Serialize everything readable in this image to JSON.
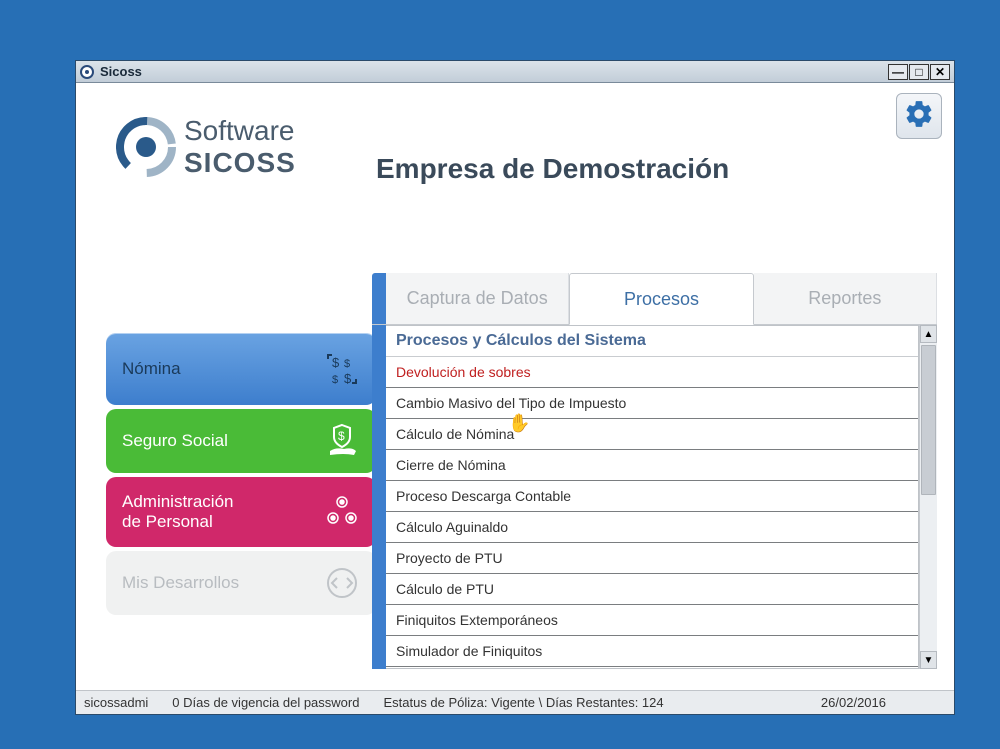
{
  "window": {
    "title": "Sicoss"
  },
  "logo": {
    "line1": "Software",
    "line2": "SICOSS"
  },
  "company": "Empresa de Demostración",
  "sidebar": {
    "items": [
      {
        "label": "Nómina"
      },
      {
        "label": "Seguro Social"
      },
      {
        "label": "Administración\nde Personal"
      },
      {
        "label": "Mis Desarrollos"
      }
    ]
  },
  "tabs": {
    "items": [
      {
        "label": "Captura de Datos"
      },
      {
        "label": "Procesos"
      },
      {
        "label": "Reportes"
      }
    ]
  },
  "list": {
    "header": "Procesos y Cálculos del Sistema",
    "items": [
      "Devolución de sobres",
      "Cambio Masivo del Tipo de Impuesto",
      "Cálculo de Nómina",
      "Cierre de Nómina",
      "Proceso Descarga Contable",
      "Cálculo Aguinaldo",
      "Proyecto de PTU",
      "Cálculo de PTU",
      "Finiquitos Extemporáneos",
      "Simulador de Finiquitos"
    ]
  },
  "status": {
    "user": "sicossadmi",
    "pwd": "0 Días de vigencia del password",
    "poliza": "Estatus de Póliza: Vigente \\ Días Restantes: 124",
    "date": "26/02/2016"
  }
}
